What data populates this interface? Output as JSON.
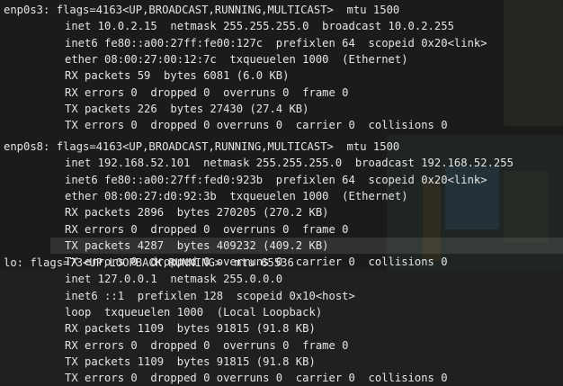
{
  "terminal": {
    "blocks": [
      {
        "name": "enp0s3",
        "header": "enp0s3: flags=4163<UP,BROADCAST,RUNNING,MULTICAST>  mtu 1500",
        "lines": [
          "inet 10.0.2.15  netmask 255.255.255.0  broadcast 10.0.2.255",
          "inet6 fe80::a00:27ff:fe00:127c  prefixlen 64  scopeid 0x20<link>",
          "ether 08:00:27:00:12:7c  txqueuelen 1000  (Ethernet)",
          "RX packets 59  bytes 6081 (6.0 KB)",
          "RX errors 0  dropped 0  overruns 0  frame 0",
          "TX packets 226  bytes 27430 (27.4 KB)",
          "TX errors 0  dropped 0 overruns 0  carrier 0  collisions 0"
        ]
      },
      {
        "name": "enp0s8",
        "header": "enp0s8: flags=4163<UP,BROADCAST,RUNNING,MULTICAST>  mtu 1500",
        "lines": [
          "inet 192.168.52.101  netmask 255.255.255.0  broadcast 192.168.52.255",
          "inet6 fe80::a00:27ff:fed0:923b  prefixlen 64  scopeid 0x20<link>",
          "ether 08:00:27:d0:92:3b  txqueuelen 1000  (Ethernet)",
          "RX packets 2896  bytes 270205 (270.2 KB)",
          "RX errors 0  dropped 0  overruns 0  frame 0",
          "TX packets 4287  bytes 409232 (409.2 KB)",
          "TX errors 0  dropped 0 overruns 0  carrier 0  collisions 0"
        ]
      },
      {
        "name": "lo",
        "header": "lo: flags=73<UP,LOOPBACK,RUNNING>  mtu 65536",
        "lines": [
          "inet 127.0.0.1  netmask 255.0.0.0",
          "inet6 ::1  prefixlen 128  scopeid 0x10<host>",
          "loop  txqueuelen 1000  (Local Loopback)",
          "RX packets 1109  bytes 91815 (91.8 KB)",
          "RX errors 0  dropped 0  overruns 0  frame 0",
          "TX packets 1109  bytes 91815 (91.8 KB)",
          "TX errors 0  dropped 0 overruns 0  carrier 0  collisions 0"
        ]
      }
    ]
  },
  "colors": {
    "background": "#1b1c19",
    "text": "#e4e4e4",
    "highlight_row": "rgba(255,255,255,0.10)"
  }
}
